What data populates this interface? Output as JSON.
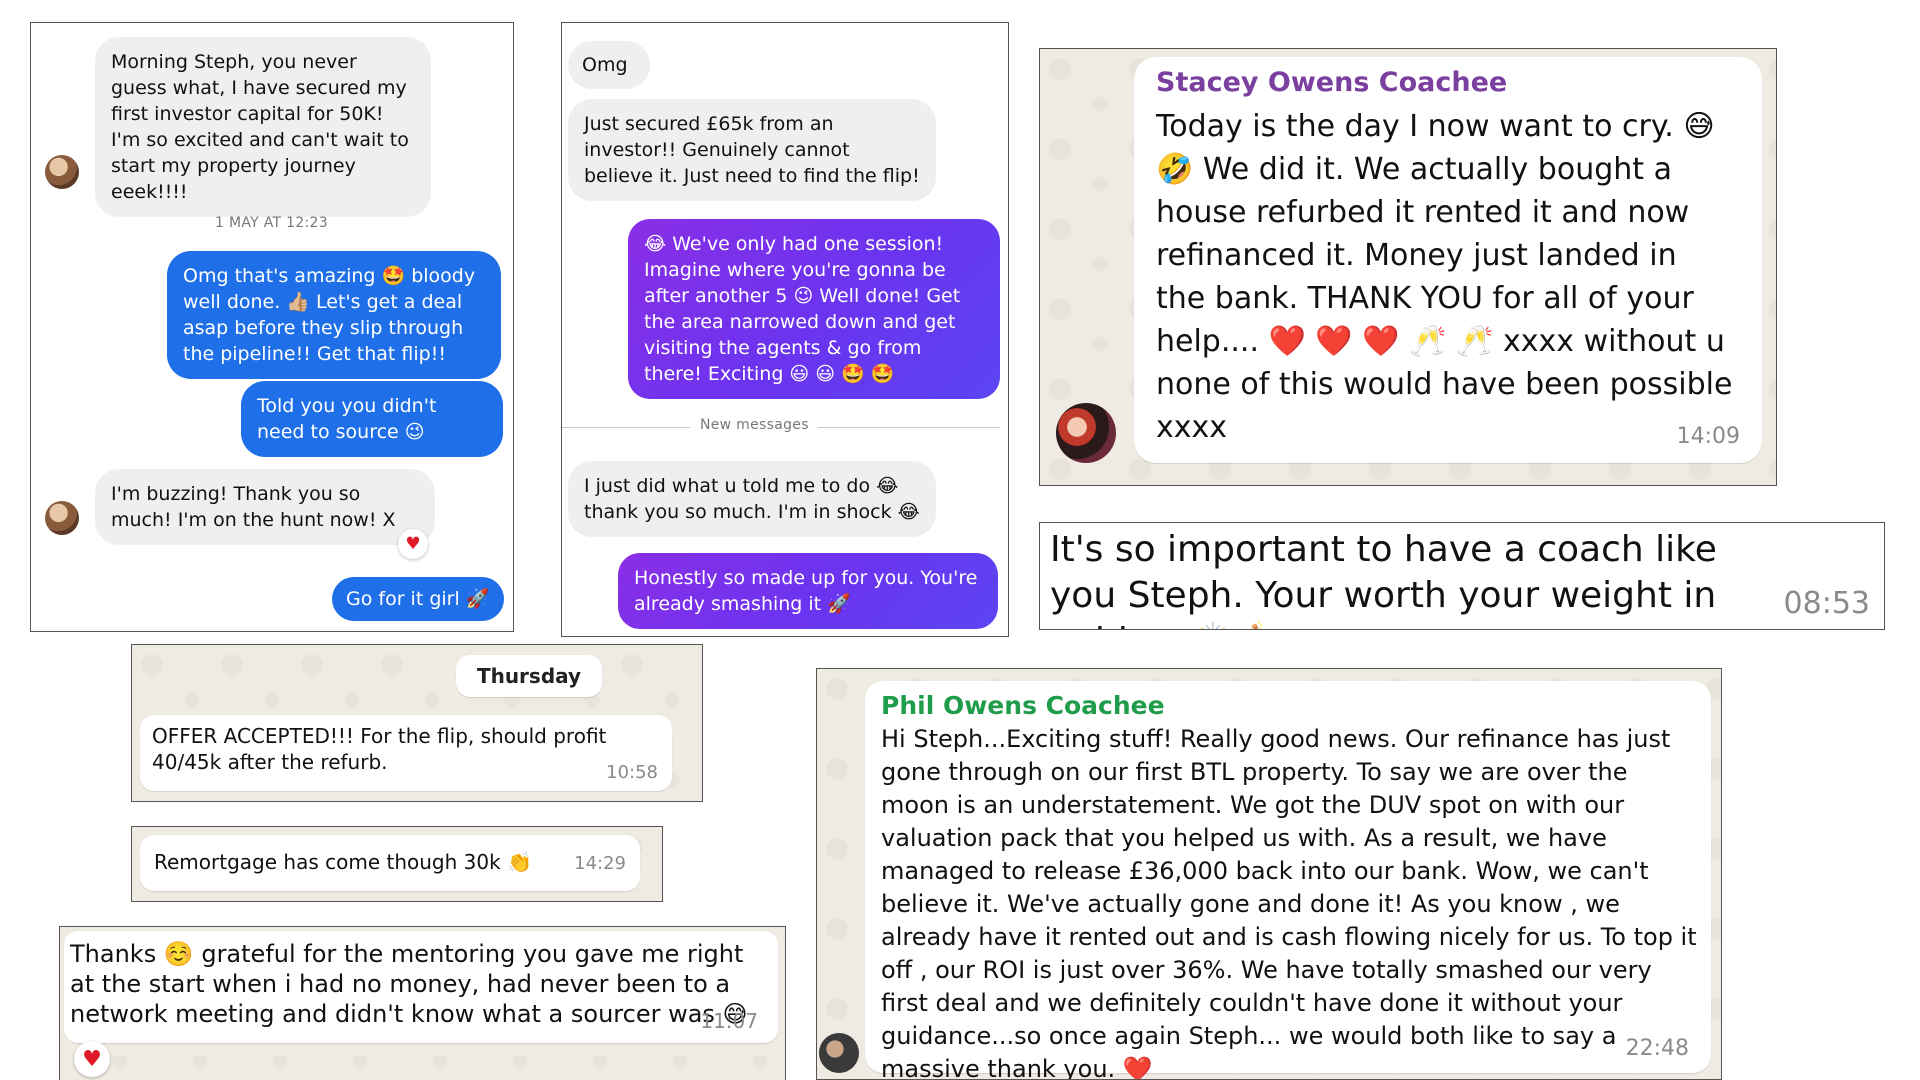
{
  "panel1": {
    "msg1": "Morning Steph, you never guess what, I have secured my first investor capital for 50K! I'm so excited and can't wait to start my property journey eeek!!!!",
    "timestamp": "1 MAY AT 12:23",
    "msg2": "Omg that's amazing 🤩 bloody well done. 👍🏼 Let's get a deal asap before they slip through the pipeline!! Get that flip!!",
    "msg3": "Told you you didn't need to source 😉",
    "msg4": "I'm buzzing! Thank you so much! I'm on the hunt now! X",
    "reaction": "♥",
    "msg5": "Go for it girl 🚀"
  },
  "panel2": {
    "msg1": "Omg",
    "msg2": "Just secured £65k from an investor!! Genuinely cannot believe it. Just need to find the flip!",
    "msg3": "😂 We've only had one session! Imagine where you're gonna be after another 5 😉 Well done! Get the area narrowed down and get visiting the agents & go from there! Exciting 😃 😃 🤩 🤩",
    "separator": "New messages",
    "msg4": "I just did what u told me to do 😂 thank you so much. I'm in shock 😂",
    "msg5": "Honestly so made up for you. You're already smashing it 🚀"
  },
  "panel3": {
    "sender": "Stacey Owens Coachee",
    "message": "Today is the day I now want to cry. 😅 🤣 We did it. We actually bought a house refurbed it rented it and now refinanced it. Money just landed in the bank. THANK YOU for all of your help.... ❤️ ❤️ ❤️ 🥂 🥂 xxxx without u none of this would have been possible xxxx",
    "time": "14:09"
  },
  "panel4": {
    "message": "It's so important to have a coach like you Steph. Your worth your weight in gold",
    "check": "✔",
    "emoji": "🙌 🍾",
    "time": "08:53"
  },
  "panel5": {
    "day": "Thursday",
    "message": "OFFER ACCEPTED!!! For the flip, should profit 40/45k after the refurb.",
    "time": "10:58"
  },
  "panel6": {
    "message": "Remortgage has come though 30k 👏",
    "time": "14:29"
  },
  "panel7": {
    "message": "Thanks ☺️ grateful for the mentoring you gave me right at the start when i had no money, had never been to a network meeting and didn't know what a sourcer was 😅",
    "time": "11:07",
    "reaction": "♥"
  },
  "panel8": {
    "sender": "Phil Owens Coachee",
    "message": "Hi Steph...Exciting stuff! Really good news. Our refinance has just gone through on our first BTL property. To say we are over the moon is an understatement.  We got the DUV spot on with our valuation pack that you helped us with. As a result, we have managed to release £36,000 back into our bank. Wow, we can't believe it. We've actually gone and done it! As you know , we already have it rented out and is cash flowing nicely for us. To top it off , our ROI is just over 36%. We have totally smashed our very first deal and we definitely couldn't have done it without your guidance...so once again Steph... we would both like to say a massive thank you. ❤️",
    "time": "22:48"
  }
}
